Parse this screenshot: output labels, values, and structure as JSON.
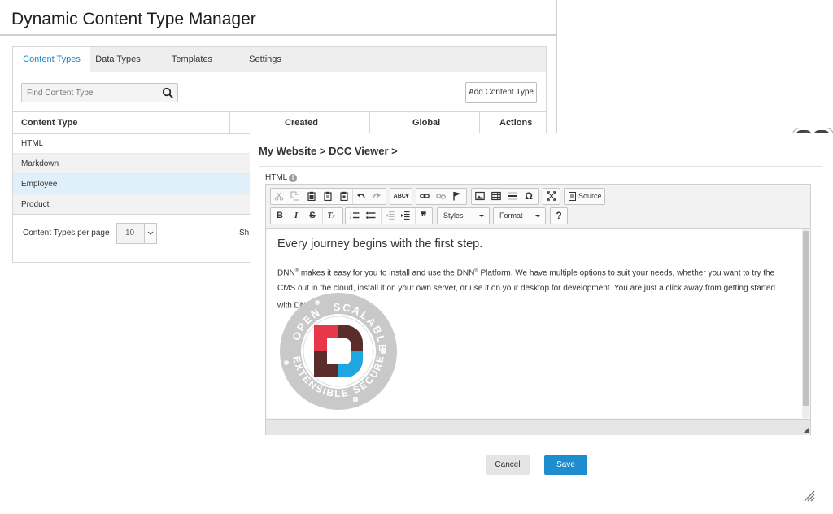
{
  "manager": {
    "title": "Dynamic Content Type Manager",
    "tabs": [
      {
        "label": "Content Types",
        "active": true
      },
      {
        "label": "Data Types",
        "active": false
      },
      {
        "label": "Templates",
        "active": false
      },
      {
        "label": "Settings",
        "active": false
      }
    ],
    "search": {
      "placeholder": "Find Content Type",
      "value": ""
    },
    "add_button": "Add Content Type",
    "table": {
      "headers": [
        "Content Type",
        "Created",
        "Global",
        "Actions"
      ],
      "rows": [
        "HTML",
        "Markdown",
        "Employee",
        "Product"
      ],
      "selected_row": "Employee"
    },
    "pager": {
      "per_page_label": "Content Types per page",
      "per_page_value": "10",
      "truncated_text": "Sh"
    }
  },
  "modal": {
    "breadcrumb": "My Website > DCC Viewer >",
    "field_label": "HTML",
    "toolbar": {
      "source_label": "Source",
      "styles_label": "Styles",
      "format_label": "Format",
      "help_label": "?"
    },
    "content": {
      "heading": "Every journey begins with the first step.",
      "para_1": "DNN",
      "para_2": " makes it easy for you to install and use the DNN",
      "para_3": " Platform. We have multiple options to suit your needs, whether you want to try the CMS out in the cloud, install it on your own server, or use it on your desktop for development. You are just a click away from getting started with DNN",
      "para_4": ".",
      "reg": "®",
      "badge_words": [
        "OPEN",
        "SCALABLE",
        "EXTENSIBLE",
        "SECURE"
      ]
    },
    "buttons": {
      "cancel": "Cancel",
      "save": "Save"
    }
  },
  "colors": {
    "accent": "#1e8dcd",
    "tab_active": "#1a8ac6",
    "selected_row": "#dff0fb",
    "dnn_red": "#e8364a",
    "dnn_blue": "#1ea6e0",
    "dnn_dark": "#5a2c2c"
  }
}
